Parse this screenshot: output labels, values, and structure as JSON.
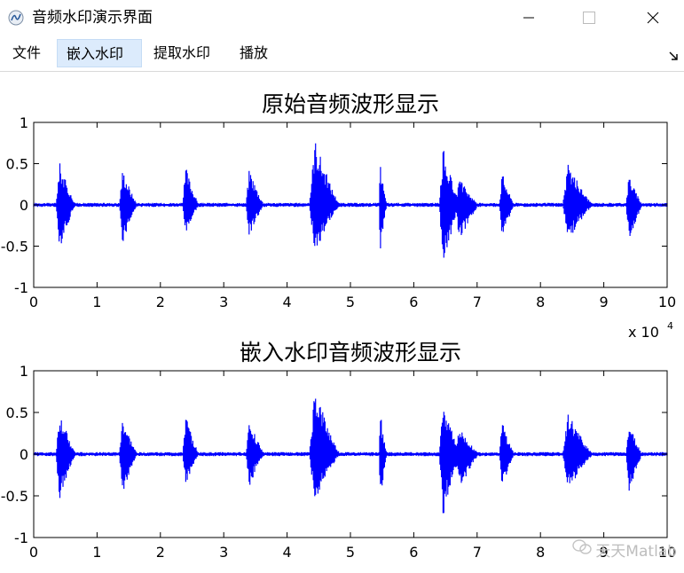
{
  "window": {
    "title": "音频水印演示界面",
    "icon": "matlab-figure-icon",
    "controls": [
      "minimize-icon",
      "maximize-icon",
      "close-icon"
    ]
  },
  "menu": {
    "items": [
      {
        "label": "文件",
        "active": false
      },
      {
        "label": "嵌入水印",
        "active": true
      },
      {
        "label": "提取水印",
        "active": false
      },
      {
        "label": "播放",
        "active": false
      }
    ],
    "dock_icon": "dock-arrow-icon"
  },
  "watermark": {
    "text": "天天Matlab",
    "icon": "wechat-icon"
  },
  "colors": {
    "wave": "#0000ff",
    "axes": "#000000",
    "text": "#000000"
  },
  "chart_data": [
    {
      "type": "line",
      "title": "原始音频波形显示",
      "xlabel": "",
      "ylabel": "",
      "x_multiplier": "x 10^4",
      "xlim": [
        0,
        10
      ],
      "ylim": [
        -1,
        1
      ],
      "xticks": [
        "0",
        "1",
        "2",
        "3",
        "4",
        "5",
        "6",
        "7",
        "8",
        "9",
        "10"
      ],
      "yticks": [
        "-1",
        "-0.5",
        "0",
        "0.5",
        "1"
      ],
      "grid": false,
      "bursts": [
        {
          "start": 0.35,
          "end": 0.68,
          "peak": 0.52,
          "trough": -0.55
        },
        {
          "start": 1.35,
          "end": 1.65,
          "peak": 0.45,
          "trough": -0.48
        },
        {
          "start": 2.35,
          "end": 2.62,
          "peak": 0.48,
          "trough": -0.38
        },
        {
          "start": 3.35,
          "end": 3.65,
          "peak": 0.46,
          "trough": -0.4
        },
        {
          "start": 4.35,
          "end": 4.85,
          "peak": 0.82,
          "trough": -0.6
        },
        {
          "start": 5.45,
          "end": 5.58,
          "peak": 0.5,
          "trough": -0.62
        },
        {
          "start": 6.4,
          "end": 6.75,
          "peak": 0.7,
          "trough": -0.75
        },
        {
          "start": 6.65,
          "end": 7.05,
          "peak": 0.32,
          "trough": -0.45
        },
        {
          "start": 7.35,
          "end": 7.6,
          "peak": 0.4,
          "trough": -0.45
        },
        {
          "start": 8.35,
          "end": 8.85,
          "peak": 0.5,
          "trough": -0.45
        },
        {
          "start": 9.35,
          "end": 9.62,
          "peak": 0.38,
          "trough": -0.48
        }
      ]
    },
    {
      "type": "line",
      "title": "嵌入水印音频波形显示",
      "xlabel": "",
      "ylabel": "",
      "x_multiplier": "",
      "xlim": [
        0,
        10
      ],
      "ylim": [
        -1,
        1
      ],
      "xticks": [
        "0",
        "1",
        "2",
        "3",
        "4",
        "5",
        "6",
        "7",
        "8",
        "9",
        "10"
      ],
      "yticks": [
        "-1",
        "-0.5",
        "0",
        "0.5",
        "1"
      ],
      "grid": false,
      "bursts": [
        {
          "start": 0.35,
          "end": 0.68,
          "peak": 0.52,
          "trough": -0.55
        },
        {
          "start": 1.35,
          "end": 1.65,
          "peak": 0.45,
          "trough": -0.48
        },
        {
          "start": 2.35,
          "end": 2.62,
          "peak": 0.48,
          "trough": -0.38
        },
        {
          "start": 3.35,
          "end": 3.65,
          "peak": 0.46,
          "trough": -0.4
        },
        {
          "start": 4.35,
          "end": 4.85,
          "peak": 0.82,
          "trough": -0.6
        },
        {
          "start": 5.45,
          "end": 5.58,
          "peak": 0.5,
          "trough": -0.62
        },
        {
          "start": 6.4,
          "end": 6.75,
          "peak": 0.7,
          "trough": -0.75
        },
        {
          "start": 6.65,
          "end": 7.05,
          "peak": 0.32,
          "trough": -0.45
        },
        {
          "start": 7.35,
          "end": 7.6,
          "peak": 0.4,
          "trough": -0.45
        },
        {
          "start": 8.35,
          "end": 8.85,
          "peak": 0.5,
          "trough": -0.45
        },
        {
          "start": 9.35,
          "end": 9.62,
          "peak": 0.38,
          "trough": -0.48
        }
      ]
    }
  ]
}
